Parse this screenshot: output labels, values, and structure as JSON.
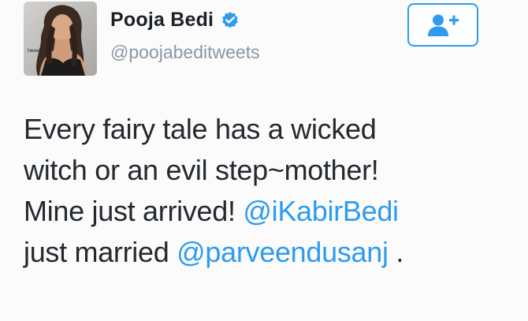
{
  "profile": {
    "display_name": "Pooja Bedi",
    "handle": "@poojabeditweets",
    "verified": true,
    "avatar_logo_text": "tweet"
  },
  "follow_button": {
    "icon": "follow-user-plus-icon",
    "accent_color": "#2f9bec"
  },
  "tweet": {
    "line1": "Every fairy tale has a wicked",
    "line2": "witch or an evil step~mother!",
    "line3_text": "Mine just arrived! ",
    "line3_mention": "@iKabirBedi",
    "line4_text": "just married ",
    "line4_mention": "@parveendusanj",
    "line4_end": " ."
  },
  "colors": {
    "mention": "#2f9bec",
    "handle": "#8899a6",
    "text": "#24292e"
  }
}
